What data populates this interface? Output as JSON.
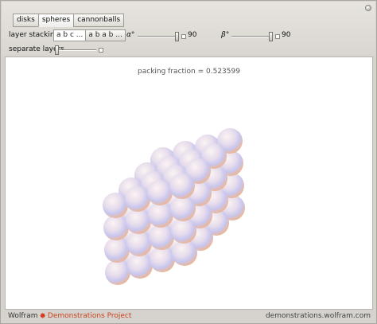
{
  "tabs": [
    {
      "label": "disks",
      "active": false
    },
    {
      "label": "spheres",
      "active": true
    },
    {
      "label": "cannonballs",
      "active": false
    }
  ],
  "layer_stacking": {
    "label": "layer stacking",
    "options": [
      {
        "label": "a b c ...",
        "active": true
      },
      {
        "label": "a b a b ...",
        "active": false
      }
    ]
  },
  "alpha": {
    "label": "α°",
    "value": "90",
    "fraction": 1.0
  },
  "beta": {
    "label": "β°",
    "value": "90",
    "fraction": 1.0
  },
  "separate_layers": {
    "label": "separate layers",
    "fraction": 0.0
  },
  "packing": {
    "text": "packing fraction = 0.523599"
  },
  "footer": {
    "wolfram": "Wolfram",
    "demonstrations": "Demonstrations Project",
    "url": "demonstrations.wolfram.com"
  },
  "colors": {
    "sphere_highlight": "#fbf3f3",
    "sphere_lavender": "#c8c6ee",
    "sphere_peach": "#f0b48a"
  }
}
